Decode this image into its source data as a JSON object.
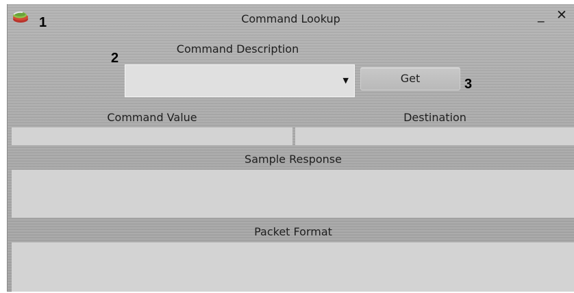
{
  "window": {
    "title": "Command Lookup",
    "minimize_glyph": "_",
    "close_glyph": "✕",
    "icon": "app-logo-icon"
  },
  "markers": {
    "one": "1",
    "two": "2",
    "three": "3"
  },
  "form": {
    "command_description_label": "Command Description",
    "command_description_value": "",
    "dropdown_arrow": "▼",
    "get_label": "Get",
    "command_value_label": "Command Value",
    "command_value_value": "",
    "destination_label": "Destination",
    "destination_value": "",
    "sample_response_label": "Sample Response",
    "sample_response_value": "",
    "packet_format_label": "Packet Format",
    "packet_format_value": ""
  },
  "colors": {
    "window_bg": "#a9a9a9",
    "field_bg": "#d3d3d3",
    "combo_bg": "#e0e0e0"
  }
}
